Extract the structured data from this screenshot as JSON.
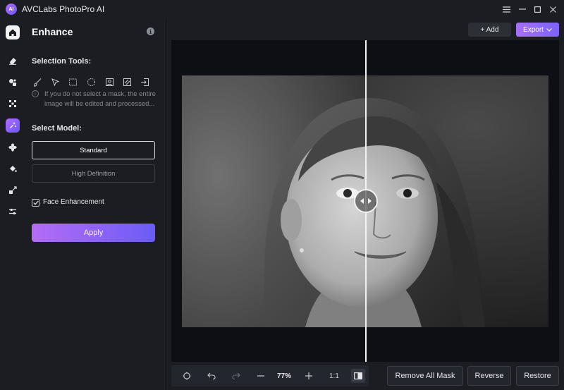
{
  "app": {
    "title": "AVCLabs PhotoPro AI",
    "logo_text": "AI"
  },
  "rail": {
    "items": [
      {
        "name": "home-icon",
        "active": false
      },
      {
        "name": "eraser-icon",
        "active": false
      },
      {
        "name": "replace-icon",
        "active": false
      },
      {
        "name": "remove-background-icon",
        "active": false
      },
      {
        "name": "enhance-icon",
        "active": true
      },
      {
        "name": "colorize-icon",
        "active": false
      },
      {
        "name": "fill-icon",
        "active": false
      },
      {
        "name": "resize-icon",
        "active": false
      },
      {
        "name": "adjust-icon",
        "active": false
      }
    ]
  },
  "panel": {
    "title": "Enhance",
    "selection_tools_label": "Selection Tools:",
    "hint": "If you do not select a mask, the entire image will be edited and processed...",
    "select_model_label": "Select Model:",
    "models": [
      "Standard",
      "High Definition"
    ],
    "selected_model": "Standard",
    "face_enhancement_label": "Face Enhancement",
    "face_enhancement_checked": true,
    "apply_label": "Apply"
  },
  "toolbar": {
    "add_label": "+ Add",
    "export_label": "Export"
  },
  "bottom": {
    "zoom": "77%",
    "ratio": "1:1",
    "remove_all_mask_label": "Remove All Mask",
    "reverse_label": "Reverse",
    "restore_label": "Restore"
  },
  "colors": {
    "accent_start": "#b06cff",
    "accent_end": "#6a57ff",
    "background": "#1b1d23"
  }
}
